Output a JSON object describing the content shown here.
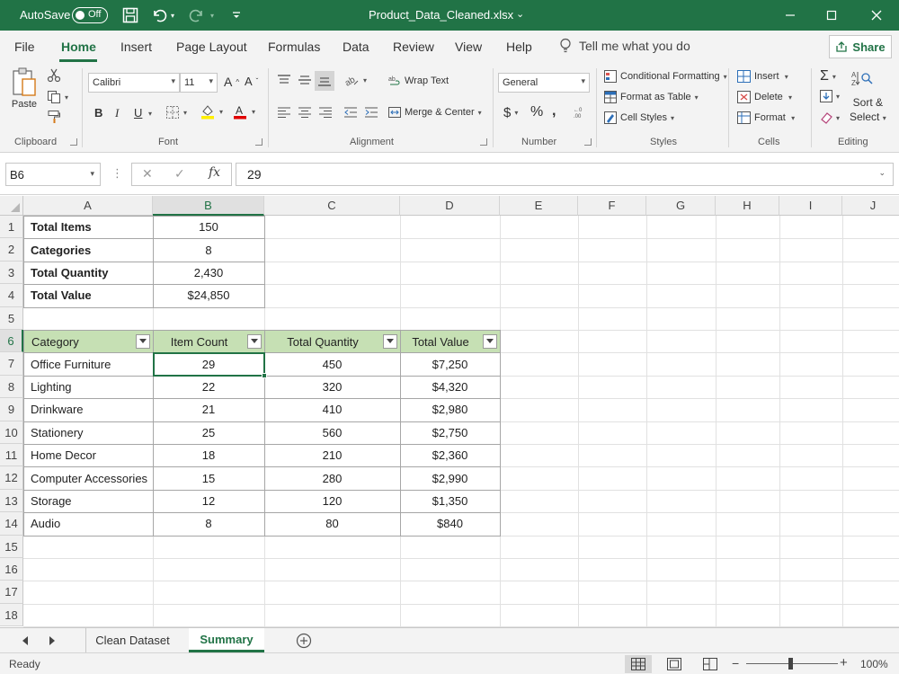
{
  "titlebar": {
    "autosave_label": "AutoSave",
    "autosave_state": "Off",
    "filename": "Product_Data_Cleaned.xlsx"
  },
  "menu": {
    "tabs": [
      "File",
      "Home",
      "Insert",
      "Page Layout",
      "Formulas",
      "Data",
      "Review",
      "View",
      "Help"
    ],
    "active_tab": "Home",
    "tell_me": "Tell me what you do",
    "tell_me_prefix": "Tell me what",
    "share": "Share"
  },
  "ribbon": {
    "clipboard": {
      "label": "Clipboard",
      "paste": "Paste"
    },
    "font": {
      "label": "Font",
      "name": "Calibri",
      "size": "11",
      "bold": "B",
      "italic": "I",
      "underline": "U"
    },
    "alignment": {
      "label": "Alignment",
      "wrap_text": "Wrap Text",
      "merge_center": "Merge & Center"
    },
    "number": {
      "label": "Number",
      "format": "General"
    },
    "styles": {
      "label": "Styles",
      "conditional": "Conditional Formatting",
      "format_table": "Format as Table",
      "cell_styles": "Cell Styles"
    },
    "cells": {
      "label": "Cells",
      "insert": "Insert",
      "delete": "Delete",
      "format": "Format"
    },
    "editing": {
      "label": "Editing",
      "sort_line1": "Sort &",
      "sort_line2": "Select"
    }
  },
  "formula_bar": {
    "name_box": "B6",
    "fx": "fx",
    "value": "29"
  },
  "grid": {
    "columns": [
      "A",
      "B",
      "C",
      "D",
      "E",
      "F",
      "G",
      "H",
      "I",
      "J"
    ],
    "selected_column": "B",
    "rows": [
      "1",
      "2",
      "3",
      "4",
      "5",
      "6",
      "7",
      "8",
      "9",
      "10",
      "11",
      "12",
      "13",
      "14",
      "15",
      "16",
      "17",
      "18"
    ],
    "selected_row": "6",
    "summary": [
      {
        "label": "Total Items",
        "value": "150"
      },
      {
        "label": "Categories",
        "value": "8"
      },
      {
        "label": "Total Quantity",
        "value": "2,430"
      },
      {
        "label": "Total Value",
        "value": "$24,850"
      }
    ],
    "table_headers": [
      "Category",
      "Item Count",
      "Total Quantity",
      "Total Value"
    ],
    "table_rows": [
      {
        "category": "Office Furniture",
        "count": "29",
        "quantity": "450",
        "value": "$7,250"
      },
      {
        "category": "Lighting",
        "count": "22",
        "quantity": "320",
        "value": "$4,320"
      },
      {
        "category": "Drinkware",
        "count": "21",
        "quantity": "410",
        "value": "$2,980"
      },
      {
        "category": "Stationery",
        "count": "25",
        "quantity": "560",
        "value": "$2,750"
      },
      {
        "category": "Home Decor",
        "count": "18",
        "quantity": "210",
        "value": "$2,360"
      },
      {
        "category": "Computer Accessories",
        "count": "15",
        "quantity": "280",
        "value": "$2,990"
      },
      {
        "category": "Storage",
        "count": "12",
        "quantity": "120",
        "value": "$1,350"
      },
      {
        "category": "Audio",
        "count": "8",
        "quantity": "80",
        "value": "$840"
      }
    ]
  },
  "sheets": {
    "tabs": [
      "Clean Dataset",
      "Summary"
    ],
    "active": "Summary"
  },
  "status": {
    "ready": "Ready",
    "zoom": "100%"
  },
  "colors": {
    "brand": "#217346",
    "table_header": "#c6e0b4"
  }
}
